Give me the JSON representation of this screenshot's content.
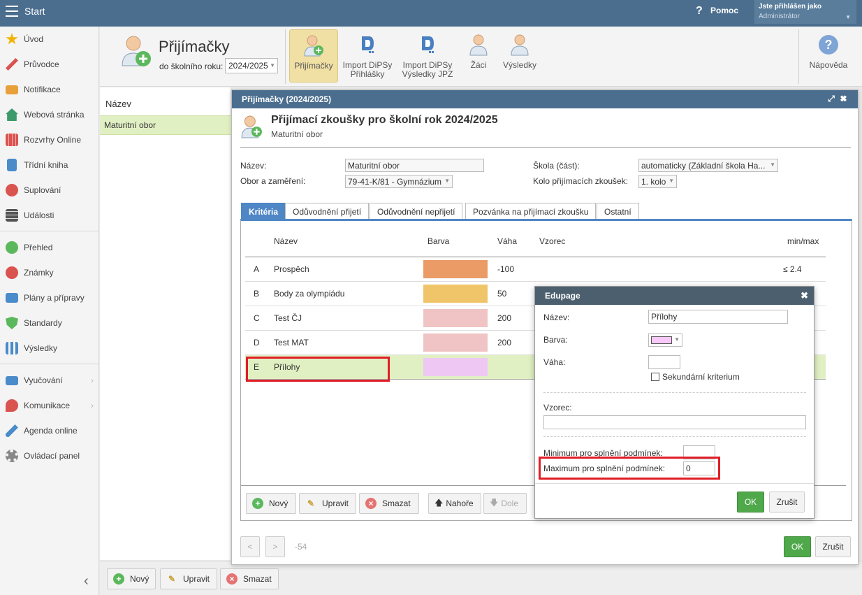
{
  "topbar": {
    "start_label": "Start",
    "help_label": "Pomoc",
    "help_glyph": "?",
    "user_line1": "Jste přihlášen jako",
    "user_line2": "Administrátor"
  },
  "sidebar": {
    "items": [
      {
        "label": "Úvod",
        "icon": "star-icon",
        "color": "#f0b400"
      },
      {
        "label": "Průvodce",
        "icon": "wand-icon",
        "color": "#d9534f"
      },
      {
        "label": "Notifikace",
        "icon": "envelope-icon",
        "color": "#e8a13a"
      },
      {
        "label": "Webová stránka",
        "icon": "home-icon",
        "color": "#3c9a6b"
      },
      {
        "label": "Rozvrhy Online",
        "icon": "grid-icon",
        "color": "#d9534f"
      },
      {
        "label": "Třídní kniha",
        "icon": "book-icon",
        "color": "#4a8bc9"
      },
      {
        "label": "Suplování",
        "icon": "person-icon",
        "color": "#d9534f"
      },
      {
        "label": "Události",
        "icon": "calendar-icon",
        "color": "#555555"
      },
      {
        "label": "Přehled",
        "icon": "check-circle-icon",
        "color": "#5cb85c"
      },
      {
        "label": "Známky",
        "icon": "grade-icon",
        "color": "#d9534f"
      },
      {
        "label": "Plány a přípravy",
        "icon": "briefcase-icon",
        "color": "#4a8bc9"
      },
      {
        "label": "Standardy",
        "icon": "shield-icon",
        "color": "#5cb85c"
      },
      {
        "label": "Výsledky",
        "icon": "bar-chart-icon",
        "color": "#4a8bc9"
      },
      {
        "label": "Vyučování",
        "icon": "open-book-icon",
        "color": "#4a8bc9"
      },
      {
        "label": "Komunikace",
        "icon": "chat-icon",
        "color": "#d9534f"
      },
      {
        "label": "Agenda online",
        "icon": "pen-icon",
        "color": "#4a8bc9"
      },
      {
        "label": "Ovládací panel",
        "icon": "gear-icon",
        "color": "#888888"
      }
    ],
    "collapse_glyph": "‹"
  },
  "toolbar": {
    "title": "Přijímačky",
    "year_label": "do školního roku:",
    "year_value": "2024/2025",
    "buttons": [
      {
        "label": "Přijímačky"
      },
      {
        "label": "Import DiPSy Přihlášky"
      },
      {
        "label": "Import DiPSy Výsledky JPZ"
      },
      {
        "label": "Žáci"
      },
      {
        "label": "Výsledky"
      },
      {
        "label": "Nápověda"
      }
    ]
  },
  "leftlist": {
    "header": "Název",
    "selected": "Maturitní obor"
  },
  "bottombar": {
    "new": "Nový",
    "edit": "Upravit",
    "delete": "Smazat"
  },
  "mainwin": {
    "header": "Přijímačky (2024/2025)",
    "title": "Přijímací zkoušky pro školní rok 2024/2025",
    "subtitle": "Maturitní obor",
    "fields": {
      "nazev_label": "Název:",
      "nazev_value": "Maturitní obor",
      "obor_label": "Obor a zaměření:",
      "obor_value": "79-41-K/81 - Gymnázium",
      "skola_label": "Škola (část):",
      "skola_value": "automaticky (Základní škola Ha...",
      "kolo_label": "Kolo přijímacích zkoušek:",
      "kolo_value": "1. kolo"
    },
    "tabs": [
      "Kritéria",
      "Odůvodnění přijetí",
      "Odůvodnění nepřijetí",
      "Pozvánka na přijímací zkoušku",
      "Ostatní"
    ],
    "table": {
      "headers": {
        "name": "Název",
        "color": "Barva",
        "weight": "Váha",
        "formula": "Vzorec",
        "minmax": "min/max"
      },
      "rows": [
        {
          "letter": "A",
          "name": "Prospěch",
          "color": "#eb9b66",
          "weight": "-100",
          "minmax": "≤ 2.4"
        },
        {
          "letter": "B",
          "name": "Body za olympiádu",
          "color": "#f0c56a",
          "weight": "50",
          "minmax": ""
        },
        {
          "letter": "C",
          "name": "Test ČJ",
          "color": "#f0c4c4",
          "weight": "200",
          "minmax": ""
        },
        {
          "letter": "D",
          "name": "Test MAT",
          "color": "#f0c4c4",
          "weight": "200",
          "minmax": ""
        },
        {
          "letter": "E",
          "name": "Přílohy",
          "color": "#eec8f2",
          "weight": "",
          "minmax": ""
        }
      ]
    },
    "actions": {
      "new": "Nový",
      "edit": "Upravit",
      "delete": "Smazat",
      "up": "Nahoře",
      "down": "Dole"
    },
    "footer": {
      "prev": "<",
      "next": ">",
      "page": "-54",
      "ok": "OK",
      "cancel": "Zrušit"
    }
  },
  "dialog": {
    "header": "Edupage",
    "name_label": "Název:",
    "name_value": "Přílohy",
    "color_label": "Barva:",
    "color_value": "#f8c8f8",
    "weight_label": "Váha:",
    "weight_value": "",
    "secondary_label": "Sekundární kriterium",
    "formula_label": "Vzorec:",
    "formula_value": "",
    "min_label": "Minimum pro splnění podmínek:",
    "min_value": "",
    "max_label": "Maximum pro splnění podmínek:",
    "max_value": "0",
    "ok": "OK",
    "cancel": "Zrušit"
  }
}
